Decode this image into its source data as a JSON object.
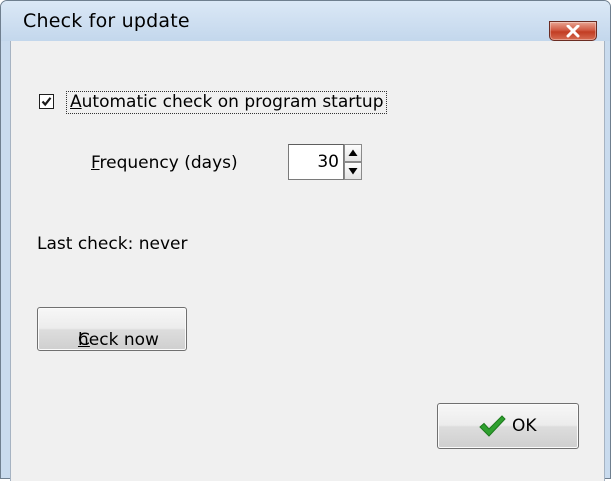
{
  "window": {
    "title": "Check for update"
  },
  "settings": {
    "auto_check_label_first": "A",
    "auto_check_label_rest": "utomatic check on program startup",
    "auto_check_checked": true,
    "frequency_label_first": "F",
    "frequency_label_rest": "requency (days)",
    "frequency_value": "30"
  },
  "status": {
    "last_check": "Last check: never"
  },
  "buttons": {
    "check_now_first": "C",
    "check_now_rest": "heck now",
    "ok_label": "OK"
  },
  "icons": {
    "close": "close-icon",
    "checkmark": "checkmark-icon",
    "spin_up": "arrow-up-icon",
    "spin_down": "arrow-down-icon",
    "ok": "green-check-icon"
  },
  "colors": {
    "title_bar": "#c3d7ec",
    "close_button": "#c94b33",
    "dialog_background": "#f0f0f0",
    "ok_check": "#2fa02f"
  }
}
